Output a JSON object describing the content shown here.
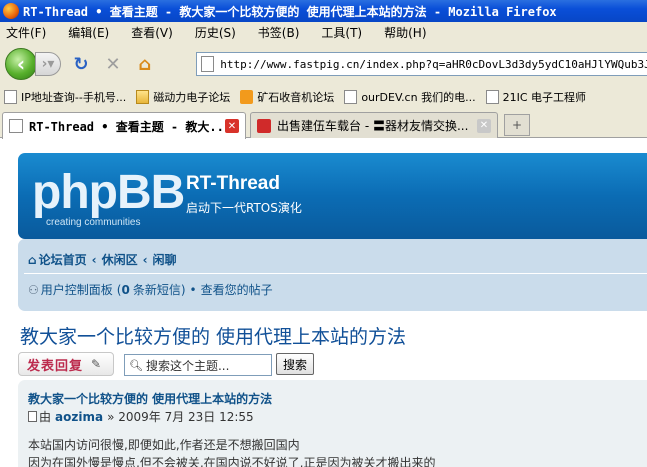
{
  "window": {
    "title": "RT-Thread • 查看主题 - 教大家一个比较方便的 使用代理上本站的方法 - Mozilla Firefox"
  },
  "menu": {
    "items": [
      "文件(F)",
      "编辑(E)",
      "查看(V)",
      "历史(S)",
      "书签(B)",
      "工具(T)",
      "帮助(H)"
    ]
  },
  "toolbar": {
    "url": "http://www.fastpig.cn/index.php?q=aHR0cDovL3d3dy5ydC10aHJlYWQub3JnL3Bo"
  },
  "bookmarks": {
    "items": [
      {
        "label": "IP地址查询--手机号...",
        "icon": "page-icon"
      },
      {
        "label": "磁动力电子论坛",
        "icon": "folder-icon"
      },
      {
        "label": "矿石收音机论坛",
        "icon": "rss-icon"
      },
      {
        "label": "ourDEV.cn 我们的电...",
        "icon": "page-icon"
      },
      {
        "label": "21IC 电子工程师",
        "icon": "page-icon"
      }
    ]
  },
  "tabs": [
    {
      "title": "RT-Thread • 查看主题 - 教大...",
      "active": true
    },
    {
      "title": "出售建伍车载台 - 〓器材友情交换...",
      "active": false
    }
  ],
  "header": {
    "logo": "phpBB",
    "logo_sub": "creating communities",
    "site_name": "RT-Thread",
    "site_desc": "启动下一代RTOS演化"
  },
  "breadcrumb": {
    "items": [
      "论坛首页",
      "休闲区",
      "闲聊"
    ],
    "separator": "‹"
  },
  "user_panel": {
    "ucp": "用户控制面板",
    "msg_prefix": "(",
    "msg_count": "0",
    "msg_suffix": "条新短信)",
    "dot": "•",
    "my_posts": "查看您的帖子"
  },
  "topic": {
    "title": "教大家一个比较方便的 使用代理上本站的方法"
  },
  "actions": {
    "reply_label": "发表回复",
    "search_placeholder": "搜索这个主题...",
    "search_button": "搜索"
  },
  "post": {
    "title": "教大家一个比较方便的 使用代理上本站的方法",
    "by": "由",
    "author": "aozima",
    "date": "» 2009年 7月 23日 12:55",
    "body_lines": [
      "本站国内访问很慢,即便如此,作者还是不想搬回国内",
      "因为在国外慢是慢点,但不会被关,在国内说不好说了,正是因为被关才搬出来的"
    ]
  },
  "colors": {
    "titlebar": "#0a4fd8",
    "chrome": "#ece9d8",
    "header_blue": "#0b6cb4",
    "nav_panel": "#cadceb",
    "link": "#105289",
    "topic_title": "#115098",
    "reply": "#bc2a4d",
    "post_bg": "#ecf1f3"
  }
}
